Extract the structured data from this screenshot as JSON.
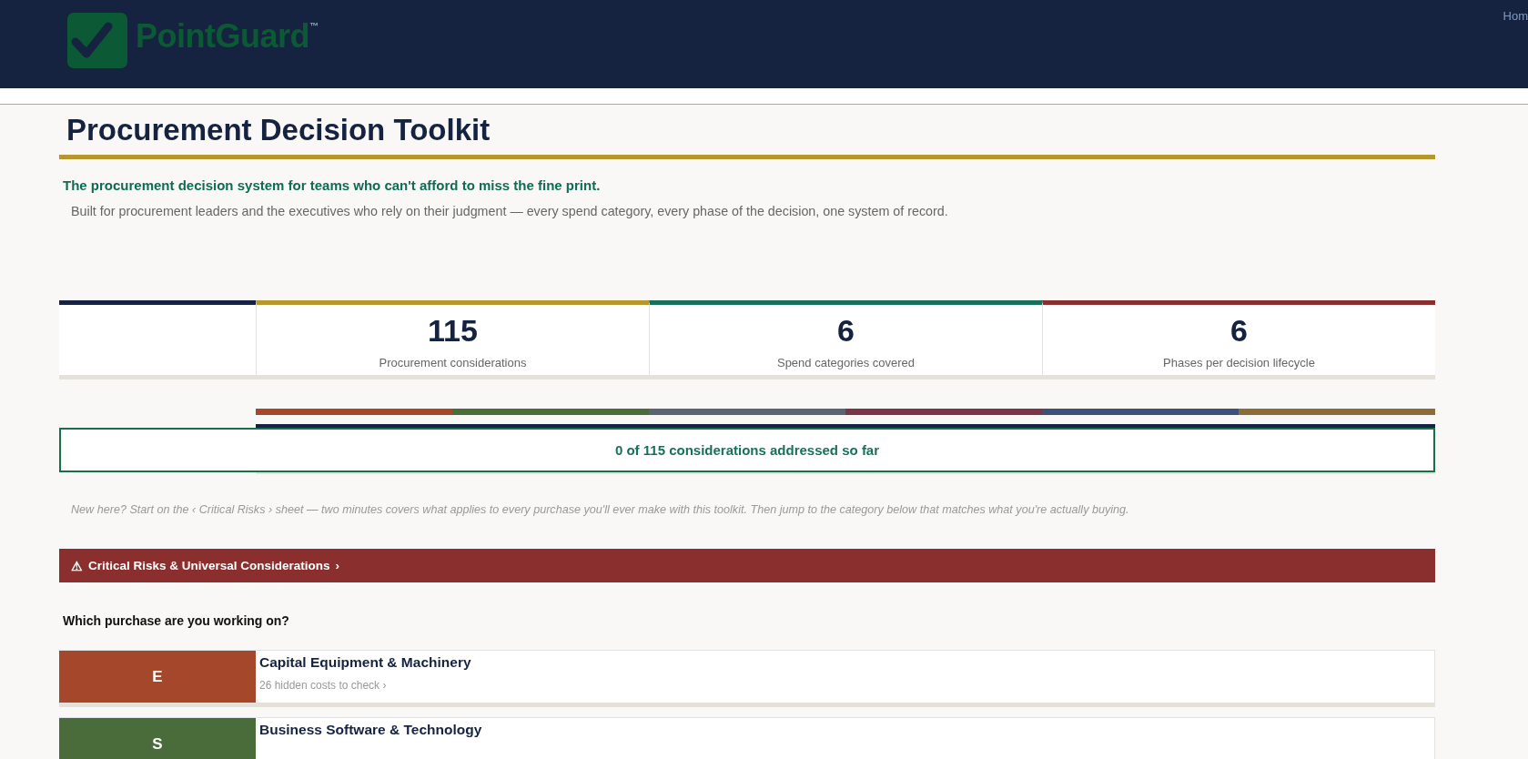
{
  "header": {
    "brand": "PointGuard$^{™}$",
    "nav": "Hom"
  },
  "title": "Procurement Decision Toolkit",
  "tagline": "The procurement decision system for teams who can't afford to miss the fine print.",
  "description": "Built for procurement leaders and the executives who rely on their judgment — every spend category, every phase of the decision, one system of record.",
  "stats": [
    {
      "value": "115",
      "label": "Procurement considerations",
      "color": "#b8962e"
    },
    {
      "value": "6",
      "label": "Spend categories covered",
      "color": "#17705a"
    },
    {
      "value": "6",
      "label": "Phases per decision lifecycle",
      "color": "#8b2e2e"
    }
  ],
  "category_strip": [
    {
      "color": "#a4472b"
    },
    {
      "color": "#4a6b3a"
    },
    {
      "color": "#5a6472"
    },
    {
      "color": "#7b3548"
    },
    {
      "color": "#3e4f7a"
    },
    {
      "color": "#8b6d3a"
    }
  ],
  "progress": {
    "text": "0 of 115 considerations addressed so far"
  },
  "hint": "New here? Start on the ‹ Critical Risks › sheet — two minutes covers what applies to every purchase you'll ever make with this toolkit. Then jump to the category below that matches what you're actually buying.",
  "risk_bar": {
    "icon": "⚠",
    "label": "Critical Risks & Universal Considerations",
    "arrow": "›"
  },
  "question": "Which purchase are you working on?",
  "categories": [
    {
      "letter": "E",
      "title": "Capital Equipment & Machinery",
      "subtitle": "26 hidden costs to check ›",
      "color": "#a4472b"
    },
    {
      "letter": "S",
      "title": "Business Software & Technology",
      "color": "#4a6b3a"
    }
  ]
}
